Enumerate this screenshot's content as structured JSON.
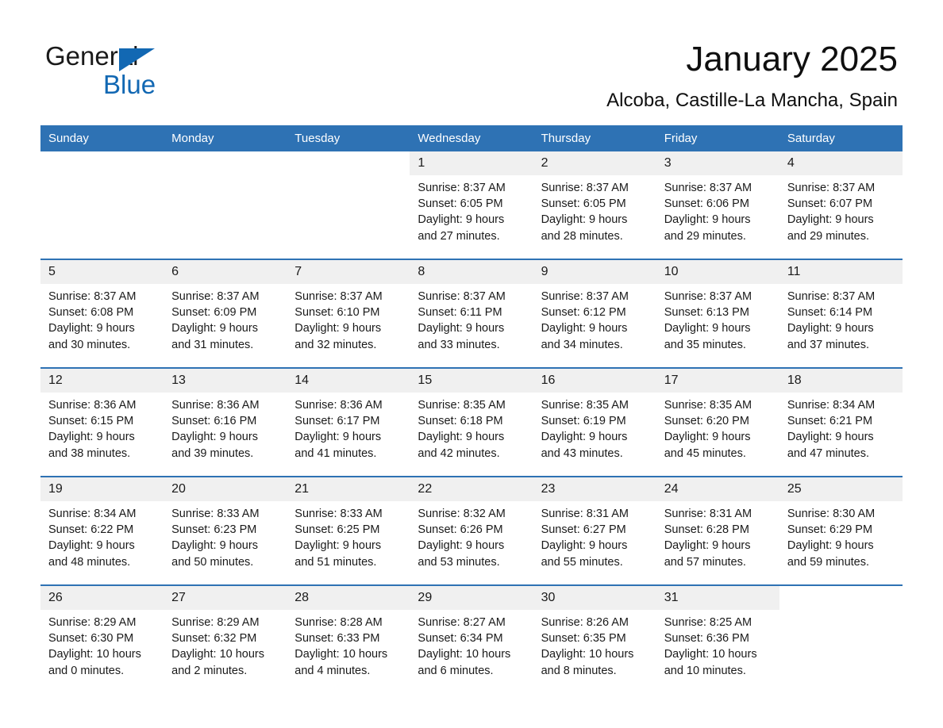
{
  "brand": {
    "name_part1": "General",
    "name_part2": "Blue",
    "logo_icon": "triangle-logo-icon",
    "accent_color": "#1268b3"
  },
  "header": {
    "title": "January 2025",
    "subtitle": "Alcoba, Castille-La Mancha, Spain"
  },
  "theme": {
    "header_bar_color": "#2e72b4",
    "week_divider_color": "#2e72b4",
    "daynum_bg": "#f0f0f0",
    "text_color": "#1a1a1a"
  },
  "weekday_headers": [
    "Sunday",
    "Monday",
    "Tuesday",
    "Wednesday",
    "Thursday",
    "Friday",
    "Saturday"
  ],
  "weeks": [
    {
      "days": [
        {
          "blank": true,
          "day": "",
          "sunrise": "",
          "sunset": "",
          "daylight_line1": "",
          "daylight_line2": ""
        },
        {
          "blank": true,
          "day": "",
          "sunrise": "",
          "sunset": "",
          "daylight_line1": "",
          "daylight_line2": ""
        },
        {
          "blank": true,
          "day": "",
          "sunrise": "",
          "sunset": "",
          "daylight_line1": "",
          "daylight_line2": ""
        },
        {
          "blank": false,
          "day": "1",
          "sunrise": "Sunrise: 8:37 AM",
          "sunset": "Sunset: 6:05 PM",
          "daylight_line1": "Daylight: 9 hours",
          "daylight_line2": "and 27 minutes."
        },
        {
          "blank": false,
          "day": "2",
          "sunrise": "Sunrise: 8:37 AM",
          "sunset": "Sunset: 6:05 PM",
          "daylight_line1": "Daylight: 9 hours",
          "daylight_line2": "and 28 minutes."
        },
        {
          "blank": false,
          "day": "3",
          "sunrise": "Sunrise: 8:37 AM",
          "sunset": "Sunset: 6:06 PM",
          "daylight_line1": "Daylight: 9 hours",
          "daylight_line2": "and 29 minutes."
        },
        {
          "blank": false,
          "day": "4",
          "sunrise": "Sunrise: 8:37 AM",
          "sunset": "Sunset: 6:07 PM",
          "daylight_line1": "Daylight: 9 hours",
          "daylight_line2": "and 29 minutes."
        }
      ]
    },
    {
      "days": [
        {
          "blank": false,
          "day": "5",
          "sunrise": "Sunrise: 8:37 AM",
          "sunset": "Sunset: 6:08 PM",
          "daylight_line1": "Daylight: 9 hours",
          "daylight_line2": "and 30 minutes."
        },
        {
          "blank": false,
          "day": "6",
          "sunrise": "Sunrise: 8:37 AM",
          "sunset": "Sunset: 6:09 PM",
          "daylight_line1": "Daylight: 9 hours",
          "daylight_line2": "and 31 minutes."
        },
        {
          "blank": false,
          "day": "7",
          "sunrise": "Sunrise: 8:37 AM",
          "sunset": "Sunset: 6:10 PM",
          "daylight_line1": "Daylight: 9 hours",
          "daylight_line2": "and 32 minutes."
        },
        {
          "blank": false,
          "day": "8",
          "sunrise": "Sunrise: 8:37 AM",
          "sunset": "Sunset: 6:11 PM",
          "daylight_line1": "Daylight: 9 hours",
          "daylight_line2": "and 33 minutes."
        },
        {
          "blank": false,
          "day": "9",
          "sunrise": "Sunrise: 8:37 AM",
          "sunset": "Sunset: 6:12 PM",
          "daylight_line1": "Daylight: 9 hours",
          "daylight_line2": "and 34 minutes."
        },
        {
          "blank": false,
          "day": "10",
          "sunrise": "Sunrise: 8:37 AM",
          "sunset": "Sunset: 6:13 PM",
          "daylight_line1": "Daylight: 9 hours",
          "daylight_line2": "and 35 minutes."
        },
        {
          "blank": false,
          "day": "11",
          "sunrise": "Sunrise: 8:37 AM",
          "sunset": "Sunset: 6:14 PM",
          "daylight_line1": "Daylight: 9 hours",
          "daylight_line2": "and 37 minutes."
        }
      ]
    },
    {
      "days": [
        {
          "blank": false,
          "day": "12",
          "sunrise": "Sunrise: 8:36 AM",
          "sunset": "Sunset: 6:15 PM",
          "daylight_line1": "Daylight: 9 hours",
          "daylight_line2": "and 38 minutes."
        },
        {
          "blank": false,
          "day": "13",
          "sunrise": "Sunrise: 8:36 AM",
          "sunset": "Sunset: 6:16 PM",
          "daylight_line1": "Daylight: 9 hours",
          "daylight_line2": "and 39 minutes."
        },
        {
          "blank": false,
          "day": "14",
          "sunrise": "Sunrise: 8:36 AM",
          "sunset": "Sunset: 6:17 PM",
          "daylight_line1": "Daylight: 9 hours",
          "daylight_line2": "and 41 minutes."
        },
        {
          "blank": false,
          "day": "15",
          "sunrise": "Sunrise: 8:35 AM",
          "sunset": "Sunset: 6:18 PM",
          "daylight_line1": "Daylight: 9 hours",
          "daylight_line2": "and 42 minutes."
        },
        {
          "blank": false,
          "day": "16",
          "sunrise": "Sunrise: 8:35 AM",
          "sunset": "Sunset: 6:19 PM",
          "daylight_line1": "Daylight: 9 hours",
          "daylight_line2": "and 43 minutes."
        },
        {
          "blank": false,
          "day": "17",
          "sunrise": "Sunrise: 8:35 AM",
          "sunset": "Sunset: 6:20 PM",
          "daylight_line1": "Daylight: 9 hours",
          "daylight_line2": "and 45 minutes."
        },
        {
          "blank": false,
          "day": "18",
          "sunrise": "Sunrise: 8:34 AM",
          "sunset": "Sunset: 6:21 PM",
          "daylight_line1": "Daylight: 9 hours",
          "daylight_line2": "and 47 minutes."
        }
      ]
    },
    {
      "days": [
        {
          "blank": false,
          "day": "19",
          "sunrise": "Sunrise: 8:34 AM",
          "sunset": "Sunset: 6:22 PM",
          "daylight_line1": "Daylight: 9 hours",
          "daylight_line2": "and 48 minutes."
        },
        {
          "blank": false,
          "day": "20",
          "sunrise": "Sunrise: 8:33 AM",
          "sunset": "Sunset: 6:23 PM",
          "daylight_line1": "Daylight: 9 hours",
          "daylight_line2": "and 50 minutes."
        },
        {
          "blank": false,
          "day": "21",
          "sunrise": "Sunrise: 8:33 AM",
          "sunset": "Sunset: 6:25 PM",
          "daylight_line1": "Daylight: 9 hours",
          "daylight_line2": "and 51 minutes."
        },
        {
          "blank": false,
          "day": "22",
          "sunrise": "Sunrise: 8:32 AM",
          "sunset": "Sunset: 6:26 PM",
          "daylight_line1": "Daylight: 9 hours",
          "daylight_line2": "and 53 minutes."
        },
        {
          "blank": false,
          "day": "23",
          "sunrise": "Sunrise: 8:31 AM",
          "sunset": "Sunset: 6:27 PM",
          "daylight_line1": "Daylight: 9 hours",
          "daylight_line2": "and 55 minutes."
        },
        {
          "blank": false,
          "day": "24",
          "sunrise": "Sunrise: 8:31 AM",
          "sunset": "Sunset: 6:28 PM",
          "daylight_line1": "Daylight: 9 hours",
          "daylight_line2": "and 57 minutes."
        },
        {
          "blank": false,
          "day": "25",
          "sunrise": "Sunrise: 8:30 AM",
          "sunset": "Sunset: 6:29 PM",
          "daylight_line1": "Daylight: 9 hours",
          "daylight_line2": "and 59 minutes."
        }
      ]
    },
    {
      "days": [
        {
          "blank": false,
          "day": "26",
          "sunrise": "Sunrise: 8:29 AM",
          "sunset": "Sunset: 6:30 PM",
          "daylight_line1": "Daylight: 10 hours",
          "daylight_line2": "and 0 minutes."
        },
        {
          "blank": false,
          "day": "27",
          "sunrise": "Sunrise: 8:29 AM",
          "sunset": "Sunset: 6:32 PM",
          "daylight_line1": "Daylight: 10 hours",
          "daylight_line2": "and 2 minutes."
        },
        {
          "blank": false,
          "day": "28",
          "sunrise": "Sunrise: 8:28 AM",
          "sunset": "Sunset: 6:33 PM",
          "daylight_line1": "Daylight: 10 hours",
          "daylight_line2": "and 4 minutes."
        },
        {
          "blank": false,
          "day": "29",
          "sunrise": "Sunrise: 8:27 AM",
          "sunset": "Sunset: 6:34 PM",
          "daylight_line1": "Daylight: 10 hours",
          "daylight_line2": "and 6 minutes."
        },
        {
          "blank": false,
          "day": "30",
          "sunrise": "Sunrise: 8:26 AM",
          "sunset": "Sunset: 6:35 PM",
          "daylight_line1": "Daylight: 10 hours",
          "daylight_line2": "and 8 minutes."
        },
        {
          "blank": false,
          "day": "31",
          "sunrise": "Sunrise: 8:25 AM",
          "sunset": "Sunset: 6:36 PM",
          "daylight_line1": "Daylight: 10 hours",
          "daylight_line2": "and 10 minutes."
        },
        {
          "blank": true,
          "day": "",
          "sunrise": "",
          "sunset": "",
          "daylight_line1": "",
          "daylight_line2": ""
        }
      ]
    }
  ]
}
